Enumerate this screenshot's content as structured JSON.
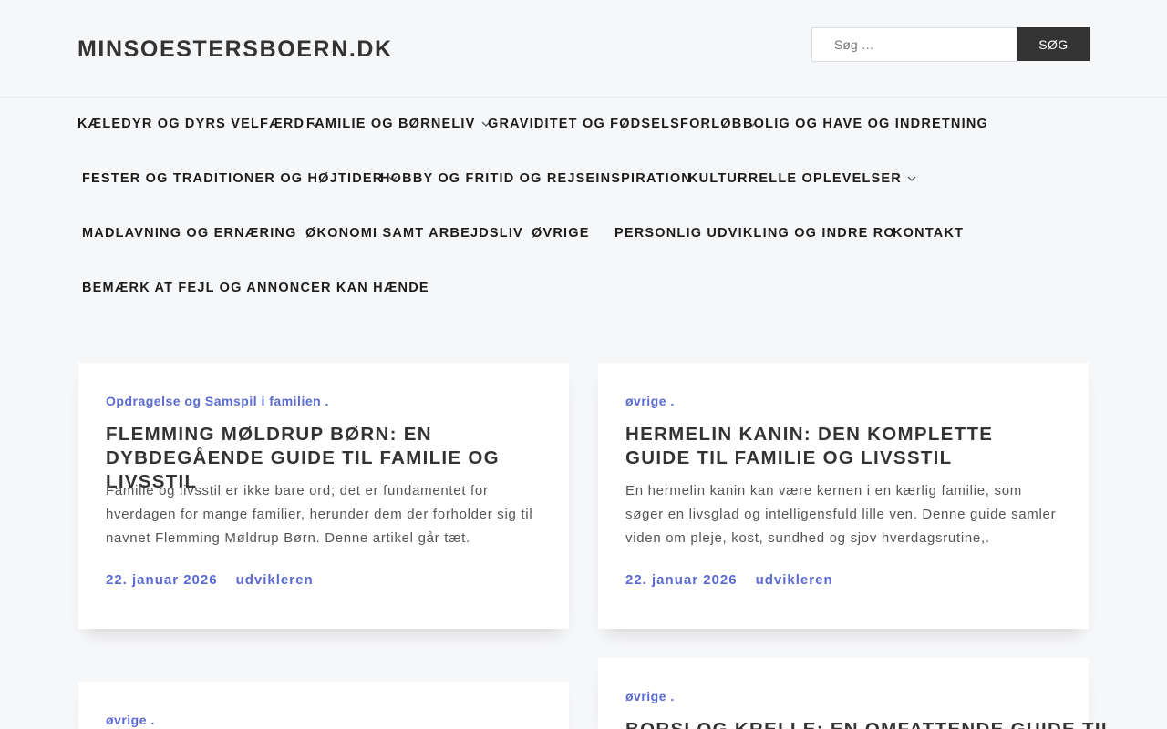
{
  "site": {
    "title": "MINSOESTERSBOERN.DK"
  },
  "search": {
    "placeholder": "Søg …",
    "button_label": "SØG"
  },
  "nav": {
    "items": [
      {
        "label": "KÆLEDYR OG DYRS VELFÆRD",
        "has_submenu": true
      },
      {
        "label": "FAMILIE OG BØRNELIV",
        "has_submenu": true
      },
      {
        "label": "GRAVIDITET OG FØDSELSFORLØB",
        "has_submenu": true
      },
      {
        "label": "BOLIG OG HAVE OG INDRETNING",
        "has_submenu": false
      },
      {
        "label": "FESTER OG TRADITIONER OG HØJTIDER",
        "has_submenu": true
      },
      {
        "label": "HOBBY OG FRITID OG REJSEINSPIRATION",
        "has_submenu": false
      },
      {
        "label": "KULTURRELLE OPLEVELSER",
        "has_submenu": true
      },
      {
        "label": "MADLAVNING OG ERNÆRING",
        "has_submenu": false
      },
      {
        "label": "ØKONOMI SAMT ARBEJDSLIV",
        "has_submenu": false
      },
      {
        "label": "ØVRIGE",
        "has_submenu": false
      },
      {
        "label": "PERSONLIG UDVIKLING OG INDRE RO",
        "has_submenu": false
      },
      {
        "label": "KONTAKT",
        "has_submenu": false
      },
      {
        "label": "BEMÆRK AT FEJL OG ANNONCER KAN HÆNDE",
        "has_submenu": false
      }
    ]
  },
  "posts": [
    {
      "category": "Opdragelse og Samspil i familien .",
      "title": "Flemming Møldrup Børn: En dybdegående guide til familie og livsstil",
      "excerpt": "Familie og livsstil er ikke bare ord; det er fundamentet for hverdagen for mange familier, herunder dem der forholder sig til navnet Flemming Møldrup Børn. Denne artikel går tæt.",
      "date": "22. januar 2026",
      "author": "udvikleren"
    },
    {
      "category": "øvrige .",
      "title": "Hermelin kanin: Den komplette guide til familie og livsstil",
      "excerpt": "En hermelin kanin kan være kernen i en kærlig familie, som søger en livsglad og intelligensfuld lille ven. Denne guide samler viden om pleje, kost, sundhed og sjov hverdagsrutine,.",
      "date": "22. januar 2026",
      "author": "udvikleren"
    },
    {
      "category": "øvrige .",
      "title": "",
      "excerpt": "",
      "date": "",
      "author": ""
    },
    {
      "category": "øvrige .",
      "title": "Borsi og Krelle: En omfattende guide til",
      "excerpt": "",
      "date": "",
      "author": ""
    }
  ],
  "colors": {
    "accent": "#5b6ad2",
    "dark": "#333333",
    "background": "#f6f7f9"
  },
  "icons": {
    "submenu": "chevron-down-icon"
  }
}
